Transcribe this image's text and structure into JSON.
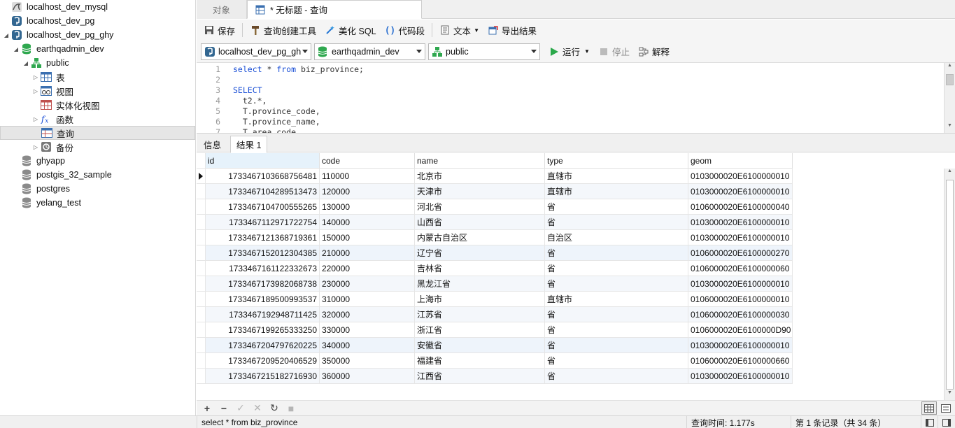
{
  "tree": [
    {
      "label": "localhost_dev_mysql",
      "icon": "mysql-connection-icon",
      "indent": 0,
      "twisty": ""
    },
    {
      "label": "localhost_dev_pg",
      "icon": "postgres-connection-icon",
      "indent": 0,
      "twisty": ""
    },
    {
      "label": "localhost_dev_pg_ghy",
      "icon": "postgres-connection-icon",
      "indent": 0,
      "twisty": "◢"
    },
    {
      "label": "earthqadmin_dev",
      "icon": "database-open-icon",
      "indent": 1,
      "twisty": "◢"
    },
    {
      "label": "public",
      "icon": "schema-icon",
      "indent": 2,
      "twisty": "◢"
    },
    {
      "label": "表",
      "icon": "table-icon",
      "indent": 3,
      "twisty": "▷"
    },
    {
      "label": "视图",
      "icon": "view-icon",
      "indent": 3,
      "twisty": "▷"
    },
    {
      "label": "实体化视图",
      "icon": "materialized-view-icon",
      "indent": 3,
      "twisty": ""
    },
    {
      "label": "函数",
      "icon": "function-icon",
      "indent": 3,
      "twisty": "▷"
    },
    {
      "label": "查询",
      "icon": "query-icon",
      "indent": 3,
      "twisty": "",
      "selected": true
    },
    {
      "label": "备份",
      "icon": "backup-icon",
      "indent": 3,
      "twisty": "▷"
    },
    {
      "label": "ghyapp",
      "icon": "database-icon",
      "indent": 1,
      "twisty": ""
    },
    {
      "label": "postgis_32_sample",
      "icon": "database-icon",
      "indent": 1,
      "twisty": ""
    },
    {
      "label": "postgres",
      "icon": "database-icon",
      "indent": 1,
      "twisty": ""
    },
    {
      "label": "yelang_test",
      "icon": "database-icon",
      "indent": 1,
      "twisty": ""
    }
  ],
  "tabs": {
    "objects": "对象",
    "query": "* 无标题 - 查询"
  },
  "toolbar": {
    "save": "保存",
    "query_builder": "查询创建工具",
    "beautify": "美化 SQL",
    "snippet": "代码段",
    "text": "文本",
    "export": "导出结果"
  },
  "toolbar2": {
    "connection": "localhost_dev_pg_gh",
    "database": "earthqadmin_dev",
    "schema": "public",
    "run": "运行",
    "stop": "停止",
    "explain": "解释"
  },
  "editor": {
    "lines": [
      {
        "n": "1",
        "text": "select * from biz_province;"
      },
      {
        "n": "2",
        "text": ""
      },
      {
        "n": "3",
        "text": "SELECT"
      },
      {
        "n": "4",
        "text": "  t2.*,"
      },
      {
        "n": "5",
        "text": "  T.province_code,"
      },
      {
        "n": "6",
        "text": "  T.province_name,"
      },
      {
        "n": "7",
        "text": "  T.area_code,"
      }
    ]
  },
  "result_tabs": {
    "info": "信息",
    "result": "结果 1"
  },
  "grid": {
    "columns": [
      "id",
      "code",
      "name",
      "type",
      "geom"
    ],
    "rows": [
      [
        "1733467103668756481",
        "110000",
        "北京市",
        "直辖市",
        "0103000020E6100000010"
      ],
      [
        "1733467104289513473",
        "120000",
        "天津市",
        "直辖市",
        "0103000020E6100000010"
      ],
      [
        "1733467104700555265",
        "130000",
        "河北省",
        "省",
        "0106000020E6100000040"
      ],
      [
        "1733467112971722754",
        "140000",
        "山西省",
        "省",
        "0103000020E6100000010"
      ],
      [
        "1733467121368719361",
        "150000",
        "内蒙古自治区",
        "自治区",
        "0103000020E6100000010"
      ],
      [
        "1733467152012304385",
        "210000",
        "辽宁省",
        "省",
        "0106000020E6100000270"
      ],
      [
        "1733467161122332673",
        "220000",
        "吉林省",
        "省",
        "0106000020E6100000060"
      ],
      [
        "1733467173982068738",
        "230000",
        "黑龙江省",
        "省",
        "0103000020E6100000010"
      ],
      [
        "1733467189500993537",
        "310000",
        "上海市",
        "直辖市",
        "0106000020E6100000010"
      ],
      [
        "1733467192948711425",
        "320000",
        "江苏省",
        "省",
        "0106000020E6100000030"
      ],
      [
        "1733467199265333250",
        "330000",
        "浙江省",
        "省",
        "0106000020E6100000D90"
      ],
      [
        "1733467204797620225",
        "340000",
        "安徽省",
        "省",
        "0103000020E6100000010"
      ],
      [
        "1733467209520406529",
        "350000",
        "福建省",
        "省",
        "0106000020E6100000660"
      ],
      [
        "1733467215182716930",
        "360000",
        "江西省",
        "省",
        "0103000020E6100000010"
      ]
    ]
  },
  "status": {
    "sql": "select * from biz_province",
    "time": "查询时间: 1.177s",
    "record": "第 1 条记录（共 34 条）"
  }
}
